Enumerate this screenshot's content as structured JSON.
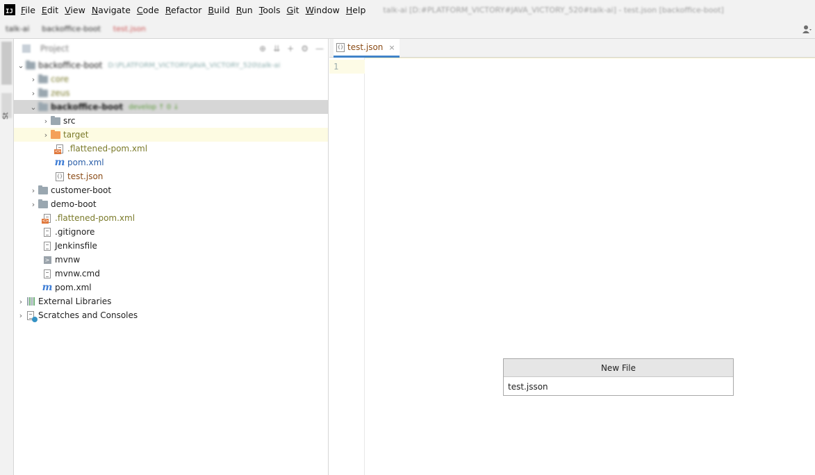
{
  "menubar": {
    "app_icon_text": "IJ",
    "items": [
      "File",
      "Edit",
      "View",
      "Navigate",
      "Code",
      "Refactor",
      "Build",
      "Run",
      "Tools",
      "Git",
      "Window",
      "Help"
    ],
    "mnemonics": [
      "F",
      "E",
      "V",
      "N",
      "C",
      "R",
      "B",
      "R",
      "T",
      "G",
      "W",
      "H"
    ],
    "window_title": "talk-ai [D:#PLATFORM_VICTORY#JAVA_VICTORY_520#talk-ai] - test.json [backoffice-boot]"
  },
  "navbar": {
    "crumbs": [
      "talk-ai",
      "backoffice-boot",
      "test.json"
    ]
  },
  "toolstrip": {
    "label": "St"
  },
  "project_panel": {
    "title": "Project",
    "tree": [
      {
        "label": "backoffice-boot",
        "extra": "D:\\PLATFORM_VICTORY\\JAVA_VICTORY_520\\talk-ai",
        "icon": "folder-icon",
        "blur": true
      },
      {
        "label": "core",
        "icon": "folder-icon",
        "blur": true
      },
      {
        "label": "zeus",
        "icon": "folder-icon",
        "blur": true
      },
      {
        "label": "backoffice-boot",
        "extra": "develop ↑ 0 ↓",
        "icon": "folder-icon",
        "blur": true
      },
      {
        "label": "src",
        "icon": "folder-icon"
      },
      {
        "label": "target",
        "icon": "folder-orange-icon"
      },
      {
        "label": ".flattened-pom.xml",
        "icon": "xml-file-icon"
      },
      {
        "label": "pom.xml",
        "icon": "maven-icon"
      },
      {
        "label": "test.json",
        "icon": "json-file-icon"
      },
      {
        "label": "customer-boot",
        "icon": "folder-icon"
      },
      {
        "label": "demo-boot",
        "icon": "folder-icon"
      },
      {
        "label": ".flattened-pom.xml",
        "icon": "xml-file-icon"
      },
      {
        "label": ".gitignore",
        "icon": "gitignore-file-icon"
      },
      {
        "label": "Jenkinsfile",
        "icon": "text-file-icon"
      },
      {
        "label": "mvnw",
        "icon": "shell-file-icon"
      },
      {
        "label": "mvnw.cmd",
        "icon": "text-file-icon"
      },
      {
        "label": "pom.xml",
        "icon": "maven-icon"
      },
      {
        "label": "External Libraries",
        "icon": "libraries-icon"
      },
      {
        "label": "Scratches and Consoles",
        "icon": "scratches-icon"
      }
    ]
  },
  "editor": {
    "tab_label": "test.json",
    "line_number": "1",
    "maven_glyph": "m",
    "json_glyph": "{}",
    "xml_glyph": "<>",
    "term_glyph": ">",
    "close_glyph": "×",
    "chevron_right": "›",
    "chevron_down": "⌄"
  },
  "new_file_popup": {
    "title": "New File",
    "value": "test.jsson"
  },
  "colors": {
    "accent_tab_underline": "#4083c9",
    "selected_row": "#d6d6d6",
    "target_highlight": "#fdfbe2",
    "file_modified_brown": "#8a4b16",
    "pom_blue": "#2a5ea8",
    "ignored_olive": "#7a7a2a"
  }
}
